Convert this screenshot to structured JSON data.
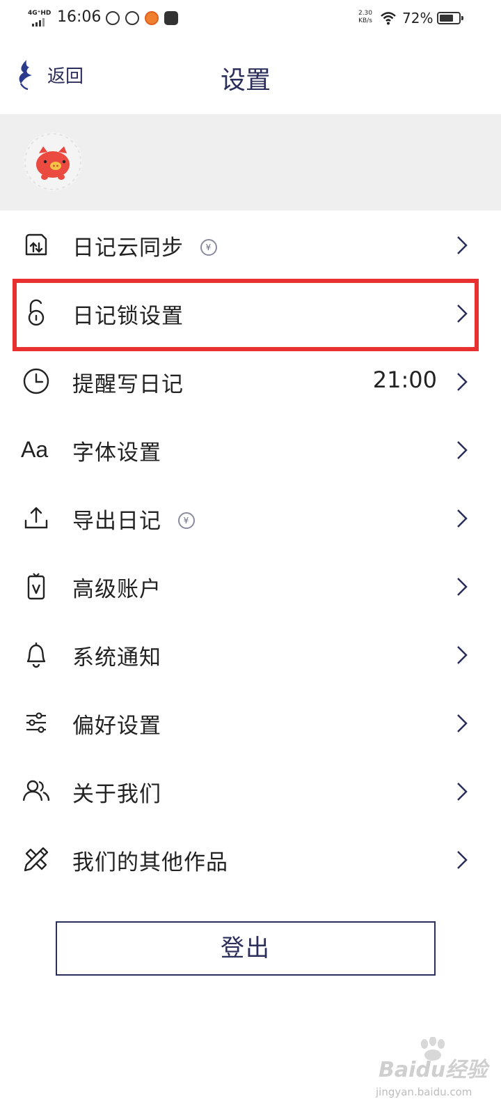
{
  "status_bar": {
    "network": "4G⁺HD",
    "time": "16:06",
    "speed_value": "2.30",
    "speed_unit": "KB/s",
    "battery": "72%",
    "battery_level": 0.72
  },
  "nav": {
    "back_label": "返回",
    "title": "设置"
  },
  "menu": {
    "items": [
      {
        "label": "日记云同步",
        "icon": "cloud-sync-icon",
        "badge": "¥"
      },
      {
        "label": "日记锁设置",
        "icon": "lock-icon",
        "highlighted": true
      },
      {
        "label": "提醒写日记",
        "icon": "clock-icon",
        "value": "21:00"
      },
      {
        "label": "字体设置",
        "icon": "font-icon",
        "icon_text": "Aa"
      },
      {
        "label": "导出日记",
        "icon": "export-icon",
        "badge": "¥"
      },
      {
        "label": "高级账户",
        "icon": "premium-card-icon"
      },
      {
        "label": "系统通知",
        "icon": "bell-icon"
      },
      {
        "label": "偏好设置",
        "icon": "sliders-icon"
      },
      {
        "label": "关于我们",
        "icon": "users-icon"
      },
      {
        "label": "我们的其他作品",
        "icon": "pencil-ruler-icon"
      }
    ]
  },
  "logout_label": "登出",
  "watermark": {
    "brand": "Baidu经验",
    "url": "jingyan.baidu.com"
  },
  "colors": {
    "accent": "#2b2d5a",
    "highlight": "#e8302e",
    "profile_bg": "#efefef"
  }
}
